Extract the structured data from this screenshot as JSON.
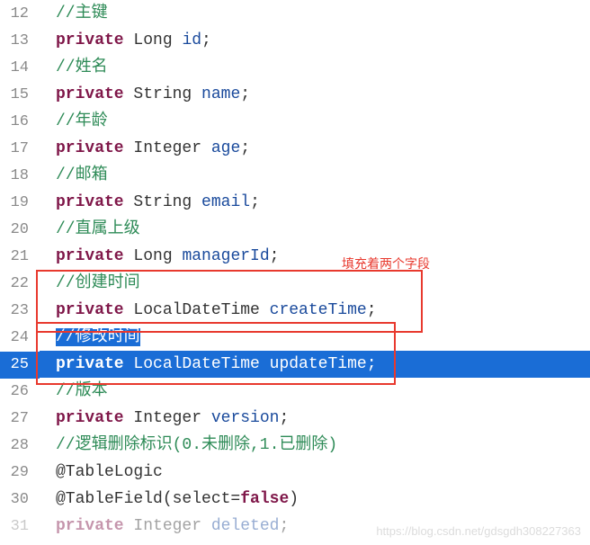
{
  "annotation_label": "填充着两个字段",
  "watermark": "https://blog.csdn.net/gdsgdh308227363",
  "lines": {
    "l12": {
      "num": "12",
      "comment": "//主键"
    },
    "l13": {
      "num": "13",
      "kw": "private",
      "type": " Long ",
      "ident": "id",
      "p": ";"
    },
    "l14": {
      "num": "14",
      "comment": "//姓名"
    },
    "l15": {
      "num": "15",
      "kw": "private",
      "type": " String ",
      "ident": "name",
      "p": ";"
    },
    "l16": {
      "num": "16",
      "comment": "//年龄"
    },
    "l17": {
      "num": "17",
      "kw": "private",
      "type": " Integer ",
      "ident": "age",
      "p": ";"
    },
    "l18": {
      "num": "18",
      "comment": "//邮箱"
    },
    "l19": {
      "num": "19",
      "kw": "private",
      "type": " String ",
      "ident": "email",
      "p": ";"
    },
    "l20": {
      "num": "20",
      "comment": "//直属上级"
    },
    "l21": {
      "num": "21",
      "kw": "private",
      "type": " Long ",
      "ident": "managerId",
      "p": ";"
    },
    "l22": {
      "num": "22",
      "comment": "//创建时间"
    },
    "l23": {
      "num": "23",
      "kw": "private",
      "type": " LocalDateTime ",
      "ident": "createTime",
      "p": ";"
    },
    "l24": {
      "num": "24",
      "comment": "//修改时间"
    },
    "l25": {
      "num": "25",
      "kw": "private",
      "type": " LocalDateTime ",
      "ident": "updateTime",
      "p": ";"
    },
    "l26": {
      "num": "26",
      "comment": "//版本"
    },
    "l27": {
      "num": "27",
      "kw": "private",
      "type": " Integer ",
      "ident": "version",
      "p": ";"
    },
    "l28": {
      "num": "28",
      "comment": "//逻辑删除标识(0.未删除,1.已删除)"
    },
    "l29": {
      "num": "29",
      "at": "@TableLogic"
    },
    "l30": {
      "num": "30",
      "at_pre": "@TableField(select=",
      "at_kw": "false",
      "at_post": ")"
    },
    "l31": {
      "num": "31",
      "kw": "private",
      "type": " Integer ",
      "ident": "deleted",
      "p": ";"
    }
  }
}
